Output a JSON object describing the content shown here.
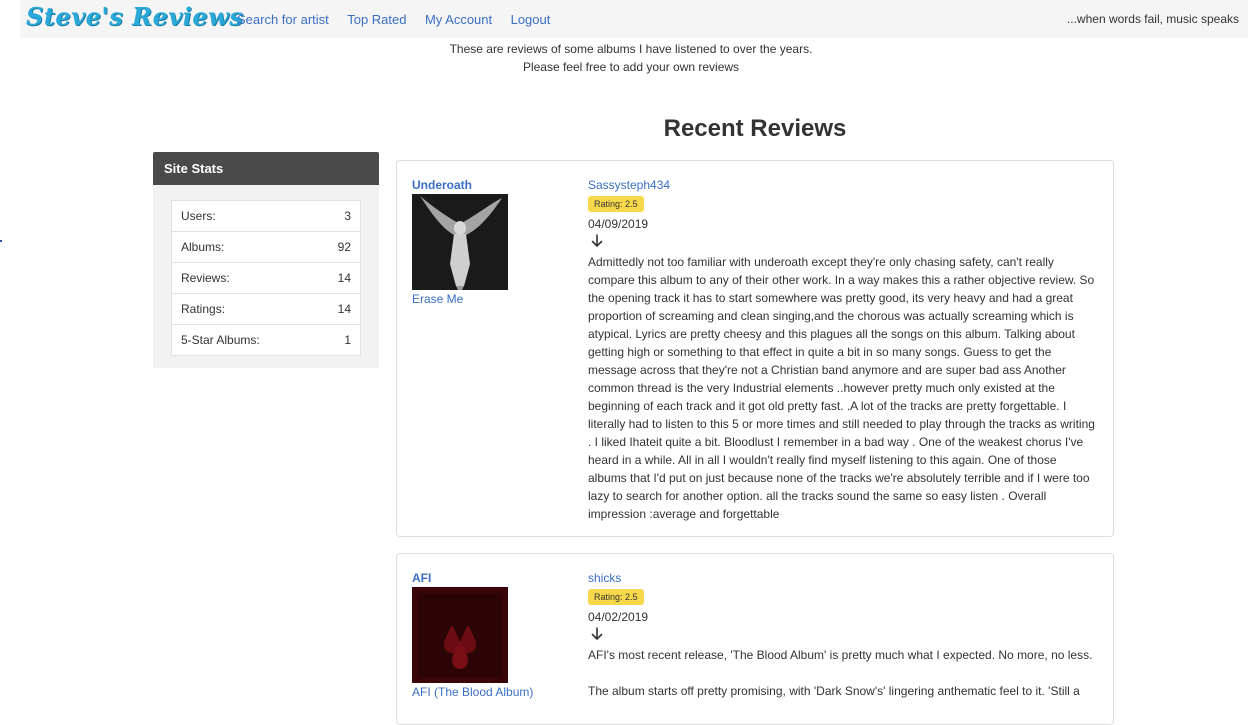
{
  "site": {
    "brand": "Steve's Reviews",
    "tagline": "...when words fail, music speaks"
  },
  "nav": {
    "links": [
      "Search for artist",
      "Top Rated",
      "My Account",
      "Logout"
    ]
  },
  "intro": {
    "line1": "These are reviews of some albums I have listened to over the years.",
    "line2": "Please feel free to add your own reviews"
  },
  "recent": {
    "title": "Recent Reviews"
  },
  "stats": {
    "title": "Site Stats",
    "rows": [
      {
        "label": "Users:",
        "value": "3"
      },
      {
        "label": "Albums:",
        "value": "92"
      },
      {
        "label": "Reviews:",
        "value": "14"
      },
      {
        "label": "Ratings:",
        "value": "14"
      },
      {
        "label": "5-Star Albums:",
        "value": "1"
      }
    ]
  },
  "reviews": [
    {
      "artist": "Underoath",
      "album": "Erase Me",
      "user": "Sassysteph434",
      "rating": "Rating: 2.5",
      "date": "04/09/2019",
      "paragraphs": [
        "Admittedly not too familiar with underoath except they're only chasing safety, can't really compare this album to any of their other work. In a way makes this a rather objective review. So the opening track it has to start somewhere was pretty good, its very heavy and had a great proportion of screaming and clean singing,and the chorous was actually screaming which is atypical. Lyrics are pretty cheesy and this plagues all the songs on this album. Talking about getting high or something to that effect in quite a bit in so many songs. Guess to get the message across that they're not a Christian band anymore and are super  bad ass  Another common thread is the very Industrial elements ..however pretty much only existed at the beginning of each track and it got old pretty fast. .A lot of the tracks are pretty forgettable. I literally had to listen to this 5 or more times and still needed to play through the tracks as writing . I liked Ihateit quite a bit. Bloodlust I remember in a bad way . One of the weakest chorus I've heard in a while. All in all I wouldn't really find myself listening to this again. One of those albums that I'd put on just because none of the tracks we're absolutely terrible and if I were too lazy to search for another option. all the tracks sound the same so easy listen . Overall impression :average and forgettable"
      ],
      "colors": {
        "cover_bg": "#1c1c1c"
      }
    },
    {
      "artist": "AFI",
      "album": "AFI (The Blood Album)",
      "user": "shicks",
      "rating": "Rating: 2.5",
      "date": "04/02/2019",
      "paragraphs": [
        "AFI's most recent release, 'The Blood Album' is pretty much what I expected.  No more, no less.",
        "The album starts off pretty promising, with 'Dark Snow's' lingering anthematic feel to it.  'Still a"
      ],
      "colors": {
        "cover_bg": "#3a0509"
      }
    }
  ],
  "colors": {
    "link": "#3a6fc4",
    "badge": "#f7d84a",
    "stats_header": "#4a4a4a",
    "navbar_bg": "#f5f5f5",
    "brand": "#2aa8d8"
  },
  "icons": [
    "arrow-down-icon"
  ]
}
